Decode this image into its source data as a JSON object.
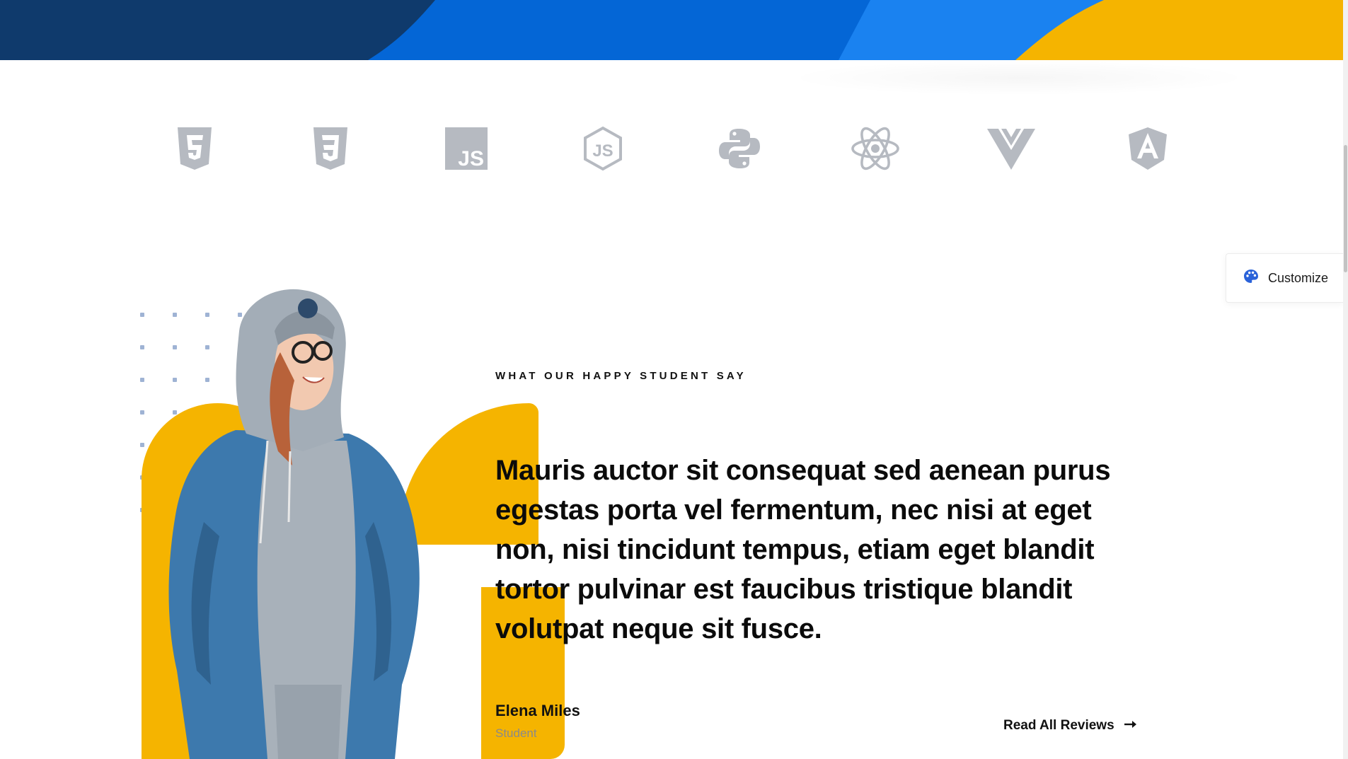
{
  "hero_band": {
    "colors": [
      "#0f3a6c",
      "#0466d6",
      "#1a82f0",
      "#f5b400"
    ]
  },
  "tech_logos": {
    "color": "#b6bac1",
    "items": [
      {
        "name": "html5-icon",
        "glyph": "5"
      },
      {
        "name": "css3-icon",
        "glyph": "3"
      },
      {
        "name": "javascript-icon",
        "glyph": "JS"
      },
      {
        "name": "nodejs-icon",
        "glyph": "JS"
      },
      {
        "name": "python-icon",
        "glyph": ""
      },
      {
        "name": "react-icon",
        "glyph": ""
      },
      {
        "name": "vue-icon",
        "glyph": ""
      },
      {
        "name": "angular-icon",
        "glyph": "A"
      }
    ]
  },
  "customize": {
    "label": "Customize",
    "icon": "palette-icon",
    "accent": "#2a62d9"
  },
  "testimonial": {
    "eyebrow": "WHAT OUR HAPPY STUDENT SAY",
    "quote": "Mauris auctor sit consequat sed aenean purus egestas porta vel fermentum, nec nisi at eget non, nisi tincidunt tempus, etiam eget blandit tortor pulvinar est faucibus tristique blandit volutpat neque sit fusce.",
    "author_name": "Elena Miles",
    "author_role": "Student",
    "read_all_label": "Read All Reviews",
    "accent": "#f5b400"
  }
}
